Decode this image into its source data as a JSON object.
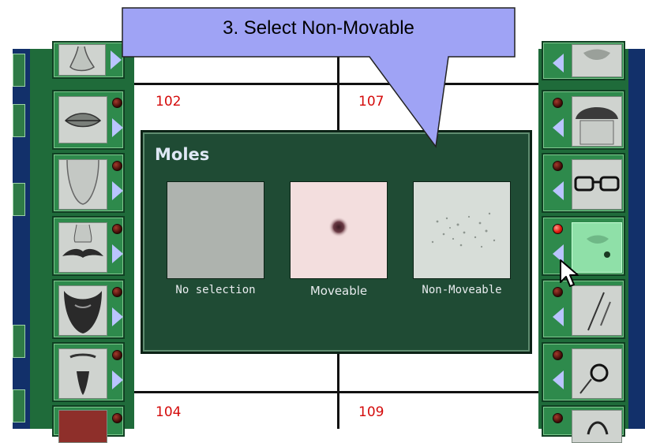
{
  "callout": {
    "text": "3. Select Non-Movable"
  },
  "grid": {
    "cells": [
      {
        "number": "102"
      },
      {
        "number": "107"
      },
      {
        "number": "104"
      },
      {
        "number": "109"
      }
    ]
  },
  "left_palette": {
    "items": [
      {
        "icon": "nose-icon"
      },
      {
        "icon": "lips-icon"
      },
      {
        "icon": "chin-icon"
      },
      {
        "icon": "mustache-icon"
      },
      {
        "icon": "beard-icon"
      },
      {
        "icon": "goatee-icon"
      },
      {
        "icon": "skin-color-icon"
      }
    ]
  },
  "right_palette": {
    "items": [
      {
        "icon": "mouth-icon"
      },
      {
        "icon": "cap-icon"
      },
      {
        "icon": "glasses-icon"
      },
      {
        "icon": "mole-icon",
        "active": true
      },
      {
        "icon": "scar-icon"
      },
      {
        "icon": "earring-icon"
      },
      {
        "icon": "accessory-icon"
      }
    ]
  },
  "dialog": {
    "title": "Moles",
    "options": [
      {
        "label": "No selection",
        "swatch_color": "#aeb3ae"
      },
      {
        "label": "Moveable",
        "swatch_color": "#f3dede"
      },
      {
        "label": "Non-Moveable",
        "swatch_color": "#d7ddd8"
      }
    ]
  },
  "colors": {
    "palette_green": "#1f6b3a",
    "dialog_green": "#1f4b34",
    "callout_fill": "#9fa3f5",
    "cell_number_red": "#d40b0b",
    "edge_navy": "#12306a"
  }
}
